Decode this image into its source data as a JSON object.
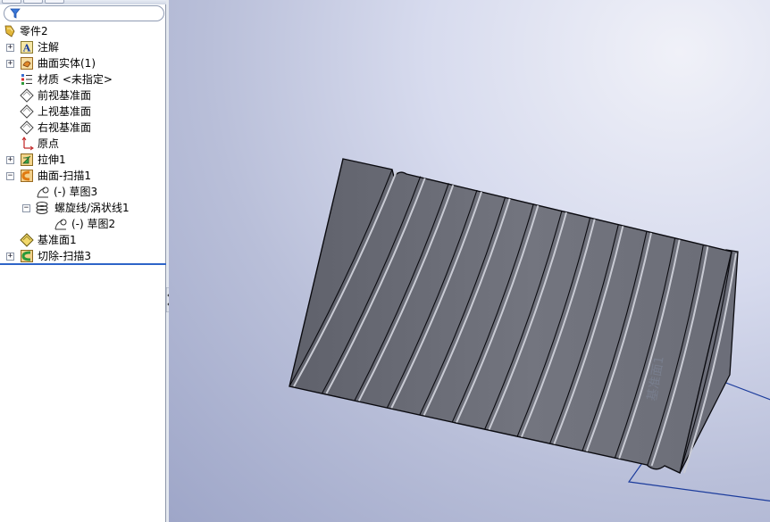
{
  "filter": {
    "placeholder": ""
  },
  "tree": {
    "root": "零件2",
    "items": [
      {
        "label": "注解",
        "icon": "annotation-icon"
      },
      {
        "label": "曲面实体(1)",
        "icon": "surface-bodies-icon"
      },
      {
        "label": "材质 <未指定>",
        "icon": "material-icon"
      },
      {
        "label": "前视基准面",
        "icon": "plane-icon"
      },
      {
        "label": "上视基准面",
        "icon": "plane-icon"
      },
      {
        "label": "右视基准面",
        "icon": "plane-icon"
      },
      {
        "label": "原点",
        "icon": "origin-icon"
      },
      {
        "label": "拉伸1",
        "icon": "extrude-icon"
      },
      {
        "label": "曲面-扫描1",
        "icon": "surface-sweep-icon"
      },
      {
        "label": "(-) 草图3",
        "icon": "sketch-icon"
      },
      {
        "label": "螺旋线/涡状线1",
        "icon": "helix-icon"
      },
      {
        "label": "(-) 草图2",
        "icon": "sketch-icon"
      },
      {
        "label": "基准面1",
        "icon": "plane-icon"
      },
      {
        "label": "切除-扫描3",
        "icon": "cut-sweep-icon"
      }
    ]
  },
  "viewport": {
    "plane_label": "基准面1",
    "colors": {
      "model_face": "#6d6f7a",
      "model_edge": "#0b0b10",
      "plane_outline": "#1c3c9c",
      "groove_highlight": "#c9cbd4"
    }
  }
}
